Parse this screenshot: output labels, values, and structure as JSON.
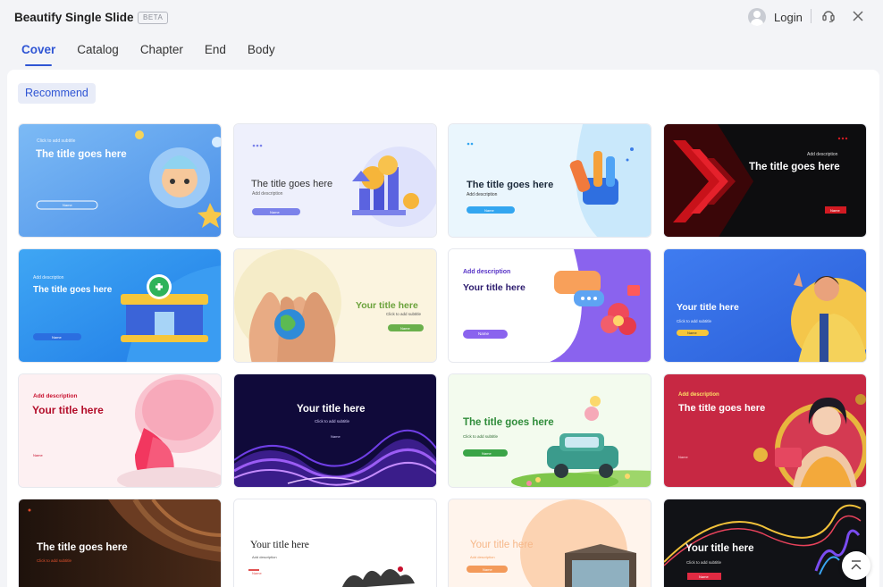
{
  "app": {
    "title": "Beautify Single Slide",
    "badge": "BETA"
  },
  "header": {
    "login_label": "Login"
  },
  "tabs": [
    {
      "label": "Cover",
      "active": true
    },
    {
      "label": "Catalog"
    },
    {
      "label": "Chapter"
    },
    {
      "label": "End"
    },
    {
      "label": "Body"
    }
  ],
  "filter": {
    "chip_label": "Recommend"
  },
  "templates": [
    {
      "subtitle": "Click to add subtitle",
      "title": "The title goes here",
      "button": "Name"
    },
    {
      "title": "The title goes here",
      "desc": "Add description",
      "button": "Name"
    },
    {
      "title": "The title goes here",
      "desc": "Add description",
      "button": "Name"
    },
    {
      "desc": "Add description",
      "title": "The title goes here",
      "button": "Name"
    },
    {
      "desc": "Add description",
      "title": "The title goes here",
      "button": "Name"
    },
    {
      "title": "Your title here",
      "subtitle": "Click to add subtitle",
      "button": "Name"
    },
    {
      "desc": "Add description",
      "title": "Your title here",
      "button": "Name"
    },
    {
      "title": "Your title here",
      "subtitle": "Click to add subtitle",
      "button": "Name"
    },
    {
      "desc": "Add description",
      "title": "Your title here",
      "button": "Name"
    },
    {
      "title": "Your title here",
      "subtitle": "Click to add subtitle",
      "button": "Name"
    },
    {
      "title": "The title goes here",
      "subtitle": "Click to add subtitle",
      "button": "Name"
    },
    {
      "desc": "Add description",
      "title": "The title goes here",
      "button": "Name"
    },
    {
      "title": "The title goes here",
      "subtitle": "Click to add subtitle"
    },
    {
      "title": "Your title here",
      "desc": "Add description",
      "button": "Name"
    },
    {
      "title": "Your title here",
      "desc": "Add description",
      "button": "Name"
    },
    {
      "title": "Your title here",
      "subtitle": "Click to add subtitle",
      "button": "Name"
    }
  ],
  "colors": {
    "accent": "#2f55d4"
  },
  "icons": {
    "scroll_top": "chevron-up-to-top-icon",
    "close": "close-icon",
    "support": "headset-icon"
  }
}
